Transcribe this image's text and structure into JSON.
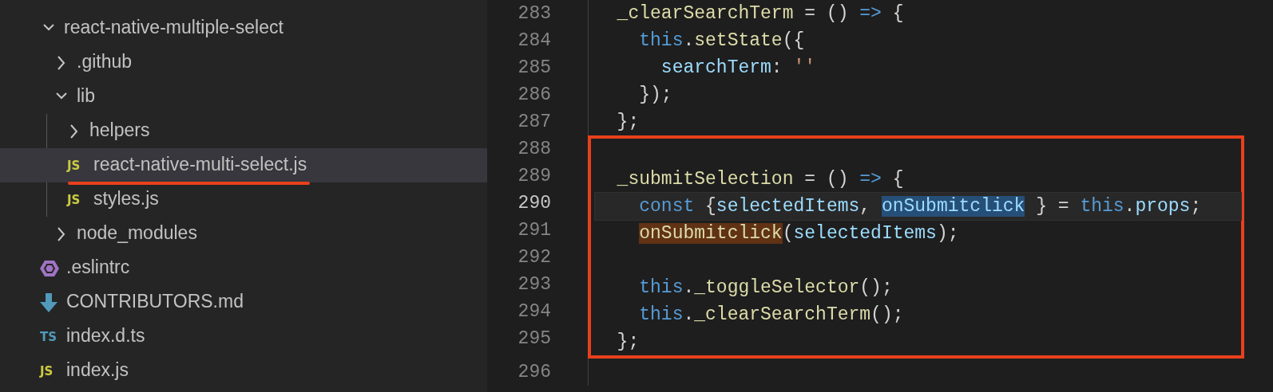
{
  "explorer": {
    "items": [
      {
        "label": "react-native-multiple-select",
        "kind": "folder",
        "expanded": true,
        "selected": false,
        "underlined": false,
        "children": [
          {
            "label": ".github",
            "kind": "folder",
            "expanded": false,
            "selected": false,
            "underlined": false
          },
          {
            "label": "lib",
            "kind": "folder",
            "expanded": true,
            "selected": false,
            "underlined": false,
            "children": [
              {
                "label": "helpers",
                "kind": "folder",
                "expanded": false,
                "selected": false,
                "underlined": false
              },
              {
                "label": "react-native-multi-select.js",
                "kind": "js",
                "badge": "JS",
                "selected": true,
                "underlined": true
              },
              {
                "label": "styles.js",
                "kind": "js",
                "badge": "JS",
                "selected": false,
                "underlined": false
              }
            ]
          },
          {
            "label": "node_modules",
            "kind": "folder",
            "expanded": false,
            "selected": false,
            "underlined": false
          }
        ]
      },
      {
        "label": ".eslintrc",
        "kind": "eslint",
        "selected": false,
        "underlined": false
      },
      {
        "label": "CONTRIBUTORS.md",
        "kind": "md",
        "selected": false,
        "underlined": false
      },
      {
        "label": "index.d.ts",
        "kind": "ts",
        "badge": "TS",
        "selected": false,
        "underlined": false
      },
      {
        "label": "index.js",
        "kind": "js",
        "badge": "JS",
        "selected": false,
        "underlined": false
      }
    ]
  },
  "editor": {
    "blocks": [
      {
        "boxed": false,
        "lines": [
          {
            "number": "283",
            "current": false,
            "tokens": [
              {
                "text": "  _clearSearchTerm",
                "kind": "fn"
              },
              {
                "text": " = () ",
                "kind": "plain"
              },
              {
                "text": "=>",
                "kind": "kw"
              },
              {
                "text": " {",
                "kind": "plain"
              }
            ]
          },
          {
            "number": "284",
            "current": false,
            "tokens": [
              {
                "text": "    this",
                "kind": "kw"
              },
              {
                "text": ".",
                "kind": "plain"
              },
              {
                "text": "setState",
                "kind": "fn"
              },
              {
                "text": "({",
                "kind": "plain"
              }
            ]
          },
          {
            "number": "285",
            "current": false,
            "tokens": [
              {
                "text": "      searchTerm",
                "kind": "var"
              },
              {
                "text": ": ",
                "kind": "plain"
              },
              {
                "text": "''",
                "kind": "str"
              }
            ]
          },
          {
            "number": "286",
            "current": false,
            "tokens": [
              {
                "text": "    });",
                "kind": "plain"
              }
            ]
          },
          {
            "number": "287",
            "current": false,
            "tokens": [
              {
                "text": "  };",
                "kind": "plain"
              }
            ]
          }
        ]
      },
      {
        "boxed": true,
        "lines": [
          {
            "number": "288",
            "current": false
          },
          {
            "number": "289",
            "current": false,
            "tokens": [
              {
                "text": "  _submitSelection",
                "kind": "fn"
              },
              {
                "text": " = () ",
                "kind": "plain"
              },
              {
                "text": "=>",
                "kind": "kw"
              },
              {
                "text": " {",
                "kind": "plain"
              }
            ]
          },
          {
            "number": "290",
            "current": true,
            "tokens": [
              {
                "text": "    const",
                "kind": "kw"
              },
              {
                "text": " {",
                "kind": "plain"
              },
              {
                "text": "selectedItems",
                "kind": "var"
              },
              {
                "text": ", ",
                "kind": "plain"
              },
              {
                "text": "onSubmitclick",
                "kind": "var",
                "selected": true
              },
              {
                "text": " } = ",
                "kind": "plain"
              },
              {
                "text": "this",
                "kind": "kw"
              },
              {
                "text": ".",
                "kind": "plain"
              },
              {
                "text": "props",
                "kind": "var"
              },
              {
                "text": ";",
                "kind": "plain"
              }
            ]
          },
          {
            "number": "291",
            "current": false,
            "tokens": [
              {
                "text": "    onSubmitclick",
                "kind": "fn",
                "matched": true
              },
              {
                "text": "(",
                "kind": "plain"
              },
              {
                "text": "selectedItems",
                "kind": "var"
              },
              {
                "text": ");",
                "kind": "plain"
              }
            ]
          },
          {
            "number": "292",
            "current": false
          },
          {
            "number": "293",
            "current": false,
            "tokens": [
              {
                "text": "    this",
                "kind": "kw"
              },
              {
                "text": "._toggleSelector",
                "kind": "fn"
              },
              {
                "text": "();",
                "kind": "plain"
              }
            ]
          },
          {
            "number": "294",
            "current": false,
            "tokens": [
              {
                "text": "    this",
                "kind": "kw"
              },
              {
                "text": "._clearSearchTerm",
                "kind": "fn"
              },
              {
                "text": "();",
                "kind": "plain"
              }
            ]
          },
          {
            "number": "295",
            "current": false,
            "tokens": [
              {
                "text": "  };",
                "kind": "plain"
              }
            ]
          }
        ]
      },
      {
        "boxed": false,
        "lines": [
          {
            "number": "296",
            "current": false
          }
        ]
      }
    ]
  }
}
